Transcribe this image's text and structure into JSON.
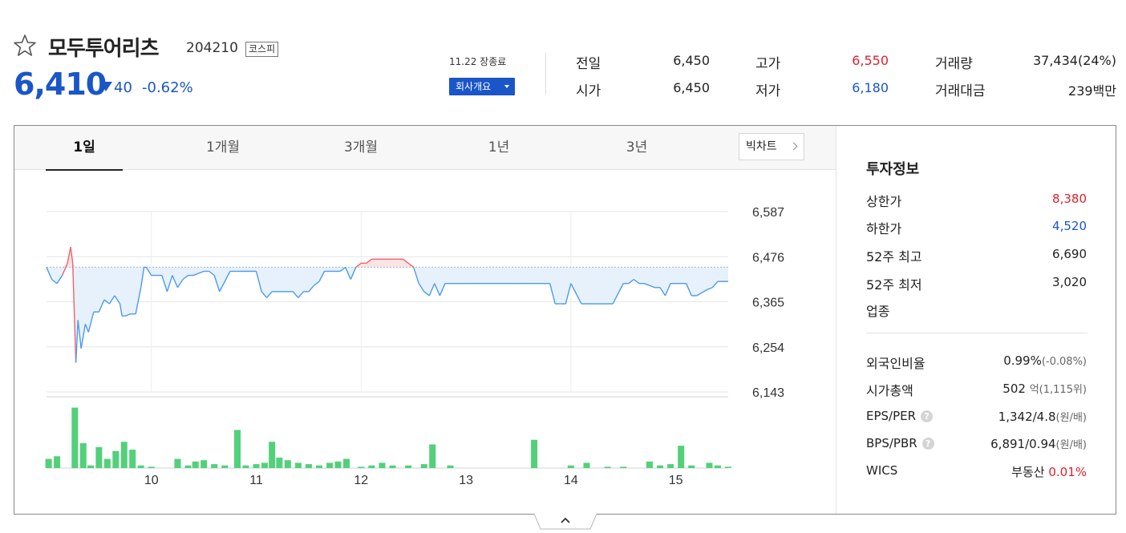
{
  "header": {
    "name": "모두투어리츠",
    "code": "204210",
    "market": "코스피",
    "price": "6,410",
    "change": "40",
    "change_pct": "-0.62%",
    "status": "11.22 장종료",
    "company_button": "회사개요"
  },
  "quotes": {
    "prev_close_label": "전일",
    "prev_close": "6,450",
    "high_label": "고가",
    "high": "6,550",
    "volume_label": "거래량",
    "volume": "37,434(24%)",
    "open_label": "시가",
    "open": "6,450",
    "low_label": "저가",
    "low": "6,180",
    "amount_label": "거래대금",
    "amount": "239백만"
  },
  "tabs": [
    "1일",
    "1개월",
    "3개월",
    "1년",
    "3년"
  ],
  "active_tab": "1일",
  "bigchart_label": "빅차트",
  "chart_data": {
    "type": "line",
    "y_ticks": [
      "6,587",
      "6,476",
      "6,365",
      "6,254",
      "6,143"
    ],
    "y_ticks_values": [
      6587,
      6476,
      6365,
      6254,
      6143
    ],
    "x_ticks": [
      "10",
      "11",
      "12",
      "13",
      "14",
      "15"
    ],
    "ylim": [
      6143,
      6587
    ],
    "xlim": [
      9.0,
      15.5
    ],
    "baseline": 6450,
    "grid": true,
    "series": [
      {
        "x": [
          9.0,
          9.05,
          9.1,
          9.15,
          9.2,
          9.23,
          9.25,
          9.28,
          9.3,
          9.33,
          9.37,
          9.4,
          9.45,
          9.5,
          9.55,
          9.6,
          9.65,
          9.7,
          9.72,
          9.75,
          9.8,
          9.85,
          9.9,
          9.93,
          9.95,
          10.0,
          10.05,
          10.1,
          10.15,
          10.2,
          10.25,
          10.3,
          10.35,
          10.4,
          10.5,
          10.55,
          10.6,
          10.65,
          10.75,
          10.8,
          10.85,
          11.0,
          11.05,
          11.1,
          11.15,
          11.25,
          11.35,
          11.4,
          11.45,
          11.5,
          11.55,
          11.6,
          11.65,
          11.7,
          11.8,
          11.85,
          11.9,
          11.95,
          12.0,
          12.05,
          12.1,
          12.2,
          12.3,
          12.4,
          12.5,
          12.55,
          12.6,
          12.65,
          12.7,
          12.75,
          12.8,
          12.85,
          12.9,
          12.95,
          13.0,
          13.5,
          13.8,
          13.85,
          13.9,
          13.95,
          14.0,
          14.1,
          14.2,
          14.35,
          14.4,
          14.5,
          14.55,
          14.6,
          14.65,
          14.7,
          14.8,
          14.85,
          14.9,
          14.95,
          15.0,
          15.1,
          15.15,
          15.2,
          15.3,
          15.35,
          15.4,
          15.5
        ],
        "y": [
          6450,
          6420,
          6410,
          6430,
          6460,
          6500,
          6460,
          6215,
          6320,
          6250,
          6310,
          6290,
          6340,
          6340,
          6370,
          6360,
          6380,
          6360,
          6330,
          6330,
          6335,
          6335,
          6400,
          6450,
          6450,
          6430,
          6430,
          6430,
          6390,
          6430,
          6400,
          6420,
          6430,
          6430,
          6440,
          6440,
          6430,
          6390,
          6440,
          6440,
          6440,
          6440,
          6390,
          6375,
          6390,
          6390,
          6390,
          6375,
          6390,
          6390,
          6405,
          6415,
          6440,
          6440,
          6440,
          6450,
          6420,
          6450,
          6460,
          6460,
          6470,
          6470,
          6470,
          6470,
          6450,
          6410,
          6390,
          6380,
          6410,
          6380,
          6410,
          6410,
          6410,
          6410,
          6410,
          6410,
          6410,
          6360,
          6360,
          6360,
          6410,
          6360,
          6360,
          6360,
          6360,
          6410,
          6410,
          6420,
          6410,
          6410,
          6400,
          6400,
          6380,
          6410,
          6410,
          6410,
          6380,
          6380,
          6395,
          6400,
          6415,
          6415
        ]
      }
    ],
    "volume": [
      {
        "x": 9.02,
        "v": 14
      },
      {
        "x": 9.1,
        "v": 18
      },
      {
        "x": 9.27,
        "v": 92
      },
      {
        "x": 9.35,
        "v": 38
      },
      {
        "x": 9.42,
        "v": 4
      },
      {
        "x": 9.5,
        "v": 32
      },
      {
        "x": 9.58,
        "v": 14
      },
      {
        "x": 9.66,
        "v": 26
      },
      {
        "x": 9.74,
        "v": 40
      },
      {
        "x": 9.82,
        "v": 28
      },
      {
        "x": 9.9,
        "v": 4
      },
      {
        "x": 10.0,
        "v": 2
      },
      {
        "x": 10.25,
        "v": 14
      },
      {
        "x": 10.35,
        "v": 4
      },
      {
        "x": 10.42,
        "v": 10
      },
      {
        "x": 10.5,
        "v": 12
      },
      {
        "x": 10.6,
        "v": 6
      },
      {
        "x": 10.7,
        "v": 4
      },
      {
        "x": 10.82,
        "v": 58
      },
      {
        "x": 10.9,
        "v": 4
      },
      {
        "x": 11.0,
        "v": 6
      },
      {
        "x": 11.08,
        "v": 8
      },
      {
        "x": 11.15,
        "v": 40
      },
      {
        "x": 11.22,
        "v": 16
      },
      {
        "x": 11.3,
        "v": 12
      },
      {
        "x": 11.4,
        "v": 8
      },
      {
        "x": 11.5,
        "v": 6
      },
      {
        "x": 11.6,
        "v": 4
      },
      {
        "x": 11.7,
        "v": 8
      },
      {
        "x": 11.78,
        "v": 10
      },
      {
        "x": 11.86,
        "v": 14
      },
      {
        "x": 12.0,
        "v": 2
      },
      {
        "x": 12.1,
        "v": 4
      },
      {
        "x": 12.2,
        "v": 8
      },
      {
        "x": 12.3,
        "v": 4
      },
      {
        "x": 12.45,
        "v": 4
      },
      {
        "x": 12.6,
        "v": 6
      },
      {
        "x": 12.68,
        "v": 36
      },
      {
        "x": 12.85,
        "v": 4
      },
      {
        "x": 13.65,
        "v": 43
      },
      {
        "x": 14.0,
        "v": 4
      },
      {
        "x": 14.15,
        "v": 8
      },
      {
        "x": 14.35,
        "v": 2
      },
      {
        "x": 14.5,
        "v": 2
      },
      {
        "x": 14.75,
        "v": 10
      },
      {
        "x": 14.85,
        "v": 4
      },
      {
        "x": 14.95,
        "v": 6
      },
      {
        "x": 15.05,
        "v": 34
      },
      {
        "x": 15.15,
        "v": 4
      },
      {
        "x": 15.32,
        "v": 8
      },
      {
        "x": 15.4,
        "v": 4
      },
      {
        "x": 15.5,
        "v": 2
      }
    ]
  },
  "invest": {
    "title": "투자정보",
    "upper_label": "상한가",
    "upper": "8,380",
    "lower_label": "하한가",
    "lower": "4,520",
    "w52_high_label": "52주 최고",
    "w52_high": "6,690",
    "w52_low_label": "52주 최저",
    "w52_low": "3,020",
    "industry_label": "업종",
    "foreign_label": "외국인비율",
    "foreign": "0.99%",
    "foreign_sub": "(-0.08%)",
    "mcap_label": "시가총액",
    "mcap": "502",
    "mcap_sub": "억(1,115위)",
    "eps_label": "EPS/PER",
    "eps": "1,342/4.8",
    "eps_sub": "(원/배)",
    "bps_label": "BPS/PBR",
    "bps": "6,891/0.94",
    "bps_sub": "(원/배)",
    "wics_label": "WICS",
    "wics": "부동산",
    "wics_pct": "0.01%",
    "help_mark": "?"
  },
  "colors": {
    "accent": "#1a56c7",
    "up": "#e0212e",
    "volume": "#52d07a",
    "line": "#4a9af0"
  }
}
